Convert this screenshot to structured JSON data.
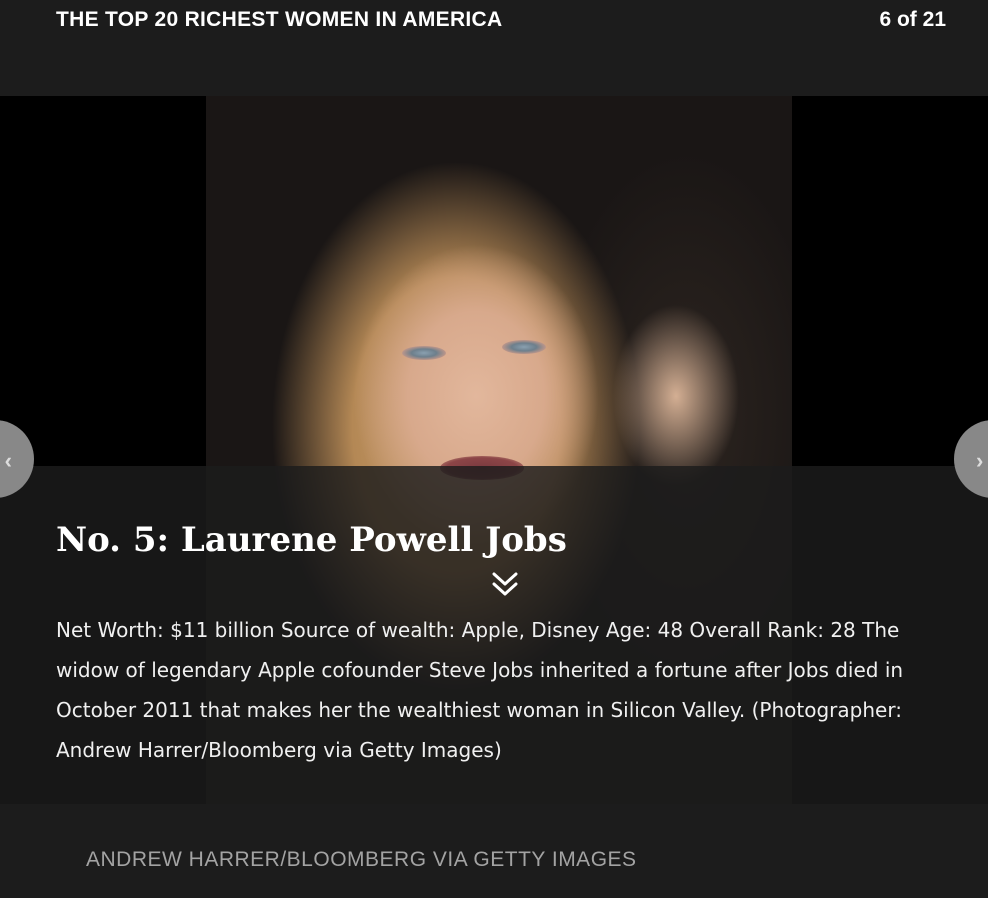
{
  "header": {
    "title": "THE TOP 20 RICHEST WOMEN IN AMERICA",
    "counter": "6 of 21"
  },
  "nav": {
    "prev_icon": "chevron-left-icon",
    "next_icon": "chevron-right-icon",
    "expand_icon": "double-chevron-down-icon"
  },
  "slide": {
    "title": "No. 5: Laurene Powell Jobs",
    "body": "Net Worth: $11 billion Source of wealth: Apple, Disney Age: 48 Overall Rank: 28 The widow of legendary Apple cofounder Steve Jobs inherited a fortune after Jobs died in October 2011 that makes her the wealthiest woman in Silicon Valley.  (Photographer: Andrew Harrer/Bloomberg via Getty Images)"
  },
  "footer": {
    "credit": "ANDREW HARRER/BLOOMBERG VIA GETTY IMAGES"
  }
}
